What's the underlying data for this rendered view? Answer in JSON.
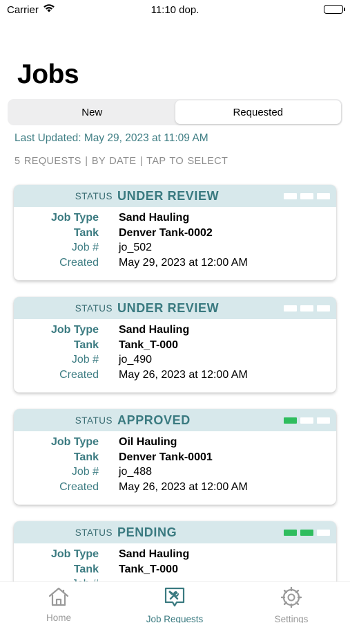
{
  "status_bar": {
    "carrier": "Carrier",
    "time": "11:10 dop."
  },
  "title": "Jobs",
  "segments": [
    {
      "label": "New",
      "selected": false
    },
    {
      "label": "Requested",
      "selected": true
    }
  ],
  "last_updated": "Last Updated: May 29, 2023 at 11:09 AM",
  "summary": "5 REQUESTS  |  BY DATE  |  TAP TO SELECT",
  "labels": {
    "status": "STATUS",
    "job_type": "Job Type",
    "tank": "Tank",
    "job_no": "Job #",
    "created": "Created"
  },
  "jobs": [
    {
      "status": "UNDER REVIEW",
      "progress_steps": 3,
      "progress_done": 0,
      "job_type": "Sand Hauling",
      "tank": "Denver Tank-0002",
      "job_no": "jo_502",
      "created": "May 29, 2023 at 12:00 AM"
    },
    {
      "status": "UNDER REVIEW",
      "progress_steps": 3,
      "progress_done": 0,
      "job_type": "Sand Hauling",
      "tank": "Tank_T-000",
      "job_no": "jo_490",
      "created": "May 26, 2023 at 12:00 AM"
    },
    {
      "status": "APPROVED",
      "progress_steps": 3,
      "progress_done": 1,
      "job_type": "Oil Hauling",
      "tank": "Denver Tank-0001",
      "job_no": "jo_488",
      "created": "May 26, 2023 at 12:00 AM"
    },
    {
      "status": "PENDING",
      "progress_steps": 3,
      "progress_done": 2,
      "job_type": "Sand Hauling",
      "tank": "Tank_T-000",
      "job_no": "",
      "created": ""
    }
  ],
  "tabs": [
    {
      "label": "Home",
      "icon": "home-icon",
      "active": false
    },
    {
      "label": "Job Requests",
      "icon": "job-requests-icon",
      "active": true
    },
    {
      "label": "Settings",
      "icon": "settings-icon",
      "active": false
    }
  ],
  "colors": {
    "accent": "#3a7a80",
    "header_bg": "#d7e8eb",
    "progress_on": "#2fbd5e",
    "progress_off": "#ffffff"
  }
}
